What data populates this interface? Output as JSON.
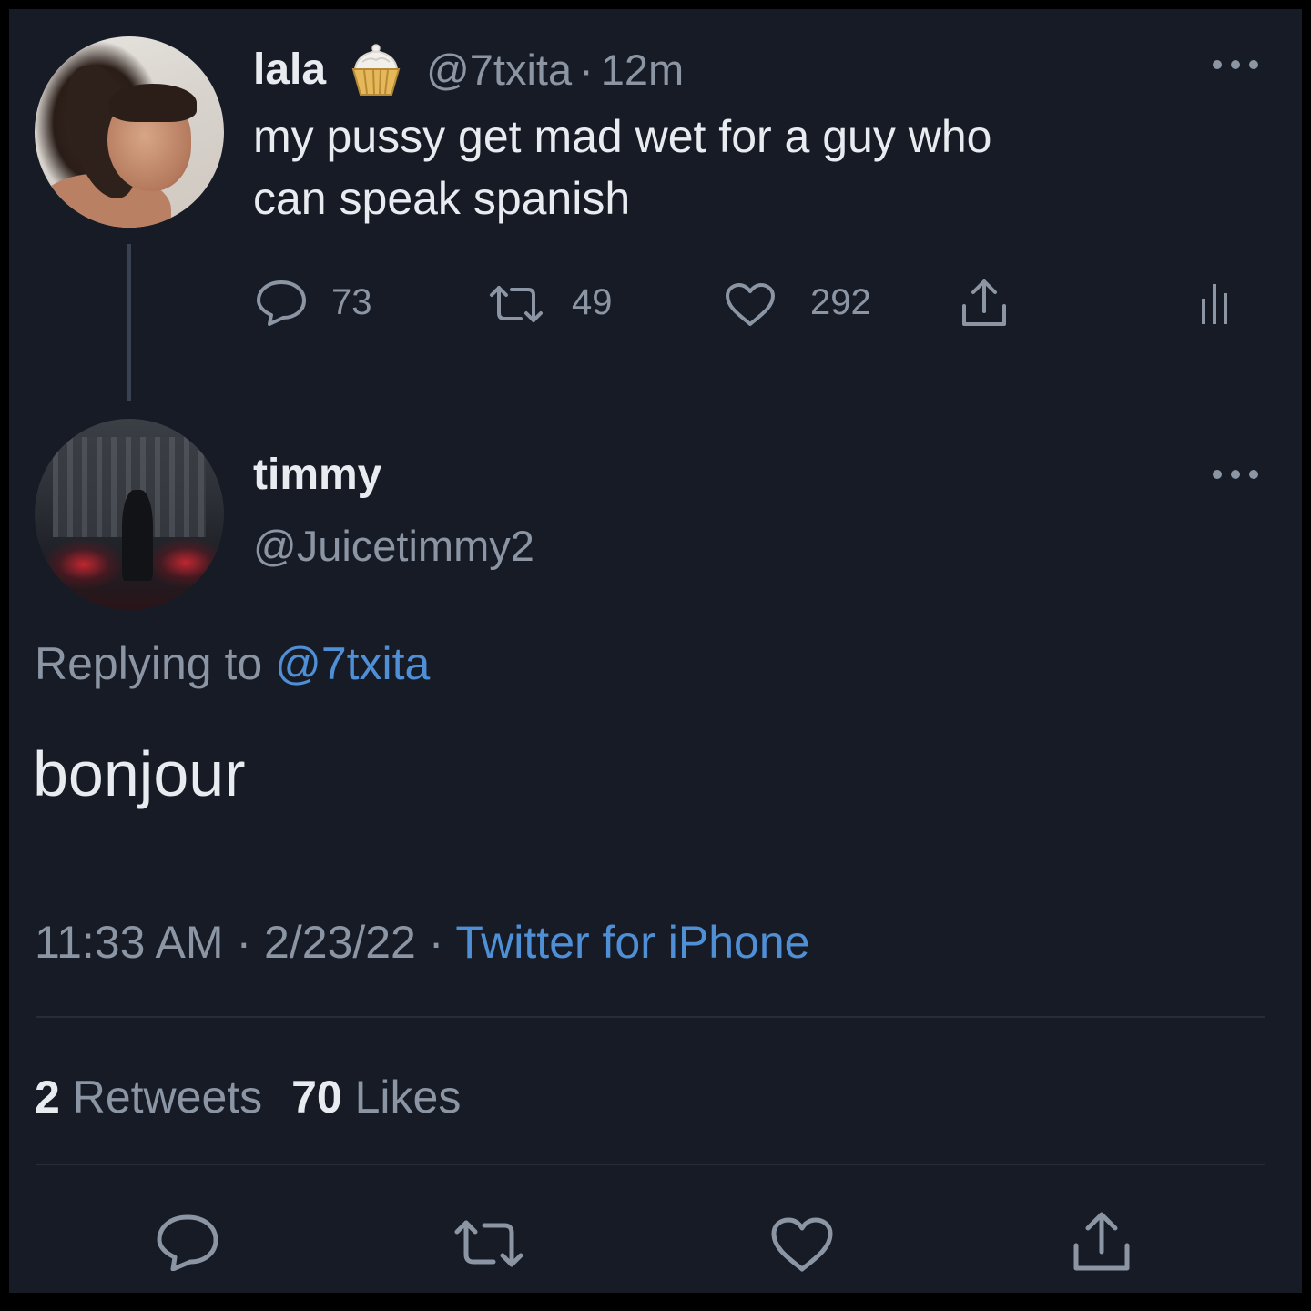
{
  "parent_tweet": {
    "display_name": "lala",
    "name_emoji": "cupcake",
    "handle": "@7txita",
    "separator": "·",
    "time_ago": "12m",
    "text_line1": "my pussy get mad wet for a guy who",
    "text_line2": "can speak spanish",
    "actions": {
      "reply_count": "73",
      "retweet_count": "49",
      "like_count": "292"
    },
    "icons": {
      "reply": "reply-icon",
      "retweet": "retweet-icon",
      "like": "heart-icon",
      "share": "share-icon",
      "analytics": "analytics-icon",
      "more": "more-icon"
    }
  },
  "reply_tweet": {
    "display_name": "timmy",
    "handle": "@Juicetimmy2",
    "replying_to_prefix": "Replying to",
    "replying_to_handle": "@7txita",
    "text": "bonjour",
    "timestamp_time": "11:33 AM",
    "separator": "·",
    "timestamp_date": "2/23/22",
    "source": "Twitter for iPhone",
    "stats": {
      "retweets_count": "2",
      "retweets_label": "Retweets",
      "likes_count": "70",
      "likes_label": "Likes"
    }
  },
  "theme": {
    "background": "#161b26",
    "text_primary": "#e8ebef",
    "text_muted": "#8b95a3",
    "link": "#4f8fd6"
  }
}
